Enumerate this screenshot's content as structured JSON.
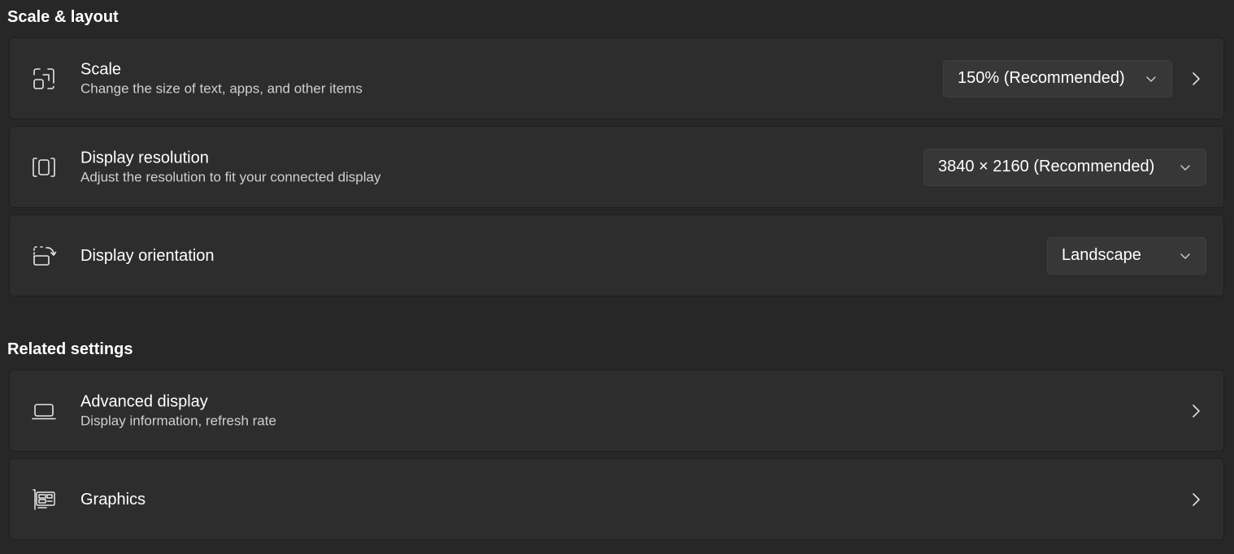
{
  "scale_layout": {
    "heading": "Scale & layout",
    "scale": {
      "title": "Scale",
      "description": "Change the size of text, apps, and other items",
      "selected": "150% (Recommended)",
      "icon": "scale-icon"
    },
    "resolution": {
      "title": "Display resolution",
      "description": "Adjust the resolution to fit your connected display",
      "selected": "3840 × 2160 (Recommended)",
      "icon": "resolution-icon"
    },
    "orientation": {
      "title": "Display orientation",
      "selected": "Landscape",
      "icon": "orientation-icon"
    }
  },
  "related": {
    "heading": "Related settings",
    "advanced_display": {
      "title": "Advanced display",
      "description": "Display information, refresh rate",
      "icon": "laptop-icon"
    },
    "graphics": {
      "title": "Graphics",
      "icon": "graphics-card-icon"
    }
  },
  "colors": {
    "background": "#272727",
    "card": "#2d2d2d",
    "dropdown": "#373737",
    "text_primary": "#ffffff",
    "text_secondary": "#cfcfcf"
  }
}
